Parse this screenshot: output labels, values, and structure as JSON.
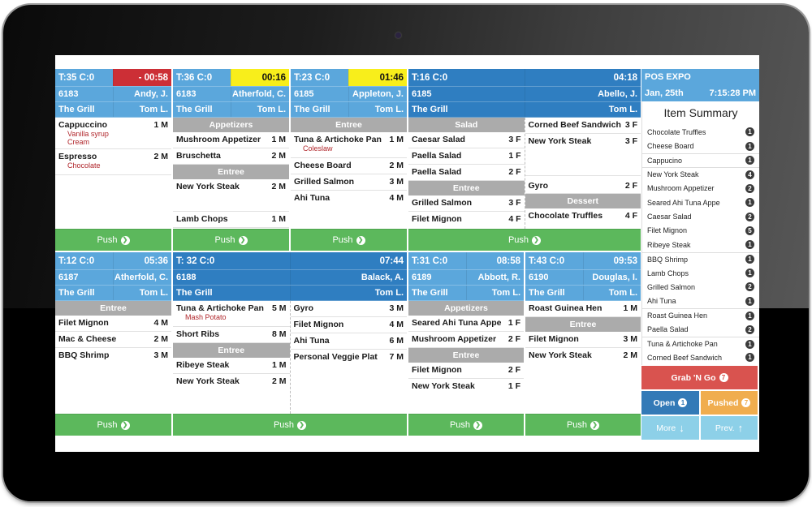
{
  "app": {
    "title": "POS EXPO",
    "date": "Jan, 25th",
    "time": "7:15:28 PM"
  },
  "colors": {
    "header_light": "#5ba7dc",
    "header_dark": "#2f7ec1",
    "timer_overdue": "#cc2f36",
    "timer_warning": "#f8ee1b",
    "push": "#5cb85c",
    "section": "#ababab",
    "modifier": "#b0262b"
  },
  "push_label": "Push",
  "tickets": [
    {
      "table": "T:35 C:0",
      "timer": "- 00:58",
      "check": "6183",
      "server": "Andy, J.",
      "station": "The Grill",
      "waiter": "Tom L.",
      "items": [
        {
          "name": "Cappuccino",
          "qty": "1 M",
          "mods": [
            "Vanilla syrup",
            "Cream"
          ]
        },
        {
          "name": "Espresso",
          "qty": "2 M",
          "mods": [
            "Chocolate"
          ]
        }
      ]
    },
    {
      "table": "T:36 C:0",
      "timer": "00:16",
      "check": "6183",
      "server": "Atherfold, C.",
      "station": "The Grill",
      "waiter": "Tom L.",
      "sections": [
        "Appetizers",
        "Entree"
      ],
      "items": [
        {
          "name": "Mushroom Appetizer",
          "qty": "1 M"
        },
        {
          "name": "Bruschetta",
          "qty": "2 M"
        },
        {
          "name": "New York Steak",
          "qty": "2 M"
        },
        {
          "name": "Lamb Chops",
          "qty": "1 M"
        }
      ]
    },
    {
      "table": "T:23 C:0",
      "timer": "01:46",
      "check": "6185",
      "server": "Appleton, J.",
      "station": "The Grill",
      "waiter": "Tom L.",
      "sections": [
        "Entree"
      ],
      "items": [
        {
          "name": "Tuna & Artichoke Pan",
          "qty": "1 M",
          "mods": [
            "Coleslaw"
          ]
        },
        {
          "name": "Cheese Board",
          "qty": "2 M"
        },
        {
          "name": "Grilled Salmon",
          "qty": "3 M"
        },
        {
          "name": "Ahi Tuna",
          "qty": "4 M"
        }
      ]
    },
    {
      "table": "T:16 C:0",
      "timer": "04:18",
      "check": "6185",
      "server": "Abello, J.",
      "station": "The Grill",
      "waiter": "Tom L.",
      "sections": [
        "Salad",
        "Entree",
        "Dessert"
      ],
      "items": [
        {
          "name": "Caesar Salad",
          "qty": "3 F"
        },
        {
          "name": "Paella Salad",
          "qty": "1 F"
        },
        {
          "name": "Paella Salad",
          "qty": "2 F"
        },
        {
          "name": "Grilled Salmon",
          "qty": "3 F"
        },
        {
          "name": "Filet Mignon",
          "qty": "4 F"
        },
        {
          "name": "Corned Beef Sandwich",
          "qty": "3 F"
        },
        {
          "name": "New York Steak",
          "qty": "3 F"
        },
        {
          "name": "Gyro",
          "qty": "2 F"
        },
        {
          "name": "Chocolate Truffles",
          "qty": "4 F"
        }
      ]
    },
    {
      "table": "T:12 C:0",
      "timer": "05:36",
      "check": "6187",
      "server": "Atherfold, C.",
      "station": "The Grill",
      "waiter": "Tom L.",
      "sections": [
        "Entree"
      ],
      "items": [
        {
          "name": "Filet Mignon",
          "qty": "4 M"
        },
        {
          "name": "Mac & Cheese",
          "qty": "2 M"
        },
        {
          "name": "BBQ Shrimp",
          "qty": "3 M"
        }
      ]
    },
    {
      "table": "T: 32 C:0",
      "timer": "07:44",
      "check": "6188",
      "server": "Balack, A.",
      "station": "The Grill",
      "waiter": "Tom L.",
      "sections": [
        "Entree"
      ],
      "items": [
        {
          "name": "Tuna & Artichoke Pan",
          "qty": "5 M",
          "mods": [
            "Mash Potato"
          ]
        },
        {
          "name": "Short Ribs",
          "qty": "8 M"
        },
        {
          "name": "Ribeye Steak",
          "qty": "1 M"
        },
        {
          "name": "New York Steak",
          "qty": "2 M"
        },
        {
          "name": "Gyro",
          "qty": "3 M"
        },
        {
          "name": "Filet Mignon",
          "qty": "4 M"
        },
        {
          "name": "Ahi Tuna",
          "qty": "6 M"
        },
        {
          "name": "Personal Veggie Plat",
          "qty": "7 M"
        }
      ]
    },
    {
      "table": "T:31 C:0",
      "timer": "08:58",
      "check": "6189",
      "server": "Abbott, R.",
      "station": "The Grill",
      "waiter": "Tom L.",
      "sections": [
        "Appetizers",
        "Entree"
      ],
      "items": [
        {
          "name": "Seared Ahi Tuna Appe",
          "qty": "1 F"
        },
        {
          "name": "Mushroom Appetizer",
          "qty": "2 F"
        },
        {
          "name": "Filet Mignon",
          "qty": "2 F"
        },
        {
          "name": "New York Steak",
          "qty": "1 F"
        }
      ]
    },
    {
      "table": "T:43 C:0",
      "timer": "09:53",
      "check": "6190",
      "server": "Douglas, I.",
      "station": "The Grill",
      "waiter": "Tom L.",
      "sections": [
        "Entree"
      ],
      "items": [
        {
          "name": "Roast Guinea Hen",
          "qty": "1 M"
        },
        {
          "name": "Filet Mignon",
          "qty": "3 M"
        },
        {
          "name": "New York Steak",
          "qty": "2 M"
        }
      ]
    }
  ],
  "summary": {
    "title": "Item Summary",
    "items": [
      {
        "name": "Chocolate Truffles",
        "count": "1"
      },
      {
        "name": "Cheese Board",
        "count": "1"
      },
      {
        "name": "Cappucino",
        "count": "1"
      },
      {
        "name": "New York Steak",
        "count": "4"
      },
      {
        "name": "Mushroom Appetizer",
        "count": "2"
      },
      {
        "name": "Seared Ahi Tuna Appe",
        "count": "1"
      },
      {
        "name": "Caesar Salad",
        "count": "2"
      },
      {
        "name": "Filet Mignon",
        "count": "5"
      },
      {
        "name": "Ribeye Steak",
        "count": "1"
      },
      {
        "name": "BBQ Shrimp",
        "count": "1"
      },
      {
        "name": "Lamb Chops",
        "count": "1"
      },
      {
        "name": "Grilled Salmon",
        "count": "2"
      },
      {
        "name": "Ahi Tuna",
        "count": "1"
      },
      {
        "name": "Roast Guinea Hen",
        "count": "1"
      },
      {
        "name": "Paella Salad",
        "count": "2"
      },
      {
        "name": "Tuna & Artichoke Pan",
        "count": "1"
      },
      {
        "name": "Corned Beef Sandwich",
        "count": "1"
      }
    ]
  },
  "buttons": {
    "grab_n_go": {
      "label": "Grab 'N Go",
      "count": "7"
    },
    "open": {
      "label": "Open",
      "count": "1"
    },
    "pushed": {
      "label": "Pushed",
      "count": "7"
    },
    "more": {
      "label": "More",
      "icon": "↓"
    },
    "prev": {
      "label": "Prev.",
      "icon": "↑"
    }
  }
}
